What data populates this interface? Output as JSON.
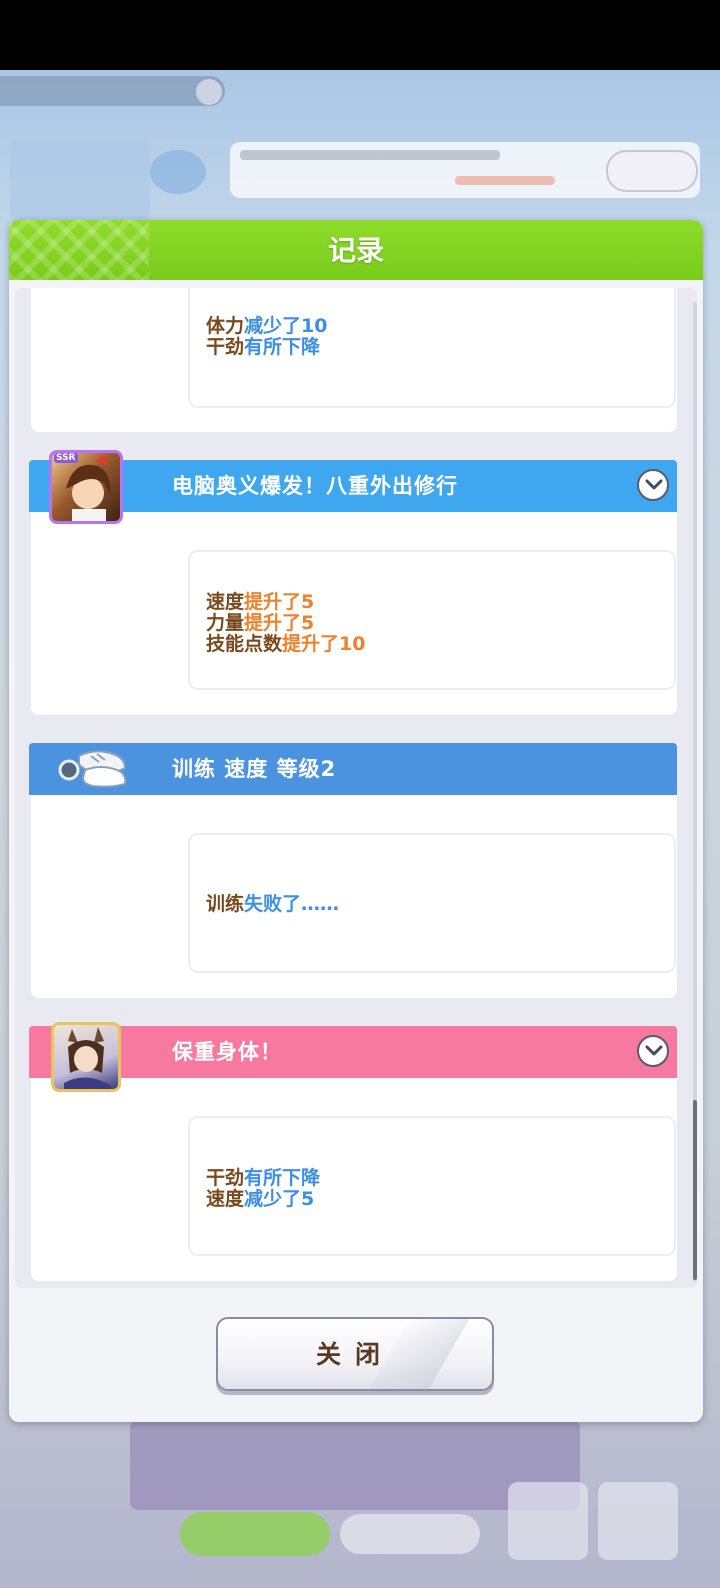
{
  "dialog": {
    "title": "记录",
    "close_label": "关闭"
  },
  "entries": [
    {
      "lines": [
        {
          "label": "体力",
          "effect": "减少了10",
          "tone": "blue"
        },
        {
          "label": "干劲",
          "effect": "有所下降",
          "tone": "blue"
        }
      ]
    },
    {
      "title": "电脑奥义爆发！八重外出修行",
      "header_color": "#3fa6f0",
      "avatar_badge": "SSR",
      "expandable": true,
      "lines": [
        {
          "label": "速度",
          "effect": "提升了5",
          "tone": "orange"
        },
        {
          "label": "力量",
          "effect": "提升了5",
          "tone": "orange"
        },
        {
          "label": "技能点数",
          "effect": "提升了10",
          "tone": "orange"
        }
      ]
    },
    {
      "title": "训练  速度  等级2",
      "header_color": "#4b93de",
      "expandable": false,
      "lines": [
        {
          "label": "训练",
          "effect": "失败了……",
          "tone": "blue"
        }
      ]
    },
    {
      "title": "保重身体！",
      "header_color": "#f8799f",
      "expandable": true,
      "lines": [
        {
          "label": "干劲",
          "effect": "有所下降",
          "tone": "blue"
        },
        {
          "label": "速度",
          "effect": "减少了5",
          "tone": "blue"
        }
      ]
    }
  ],
  "colors": {
    "header_green": "#86d624",
    "label_brown": "#7a4a1e",
    "decrease_blue": "#3c8ee6",
    "increase_orange": "#f0802a"
  },
  "icons": {
    "expand": "chevron-down-icon",
    "training": "shoes-icon"
  }
}
